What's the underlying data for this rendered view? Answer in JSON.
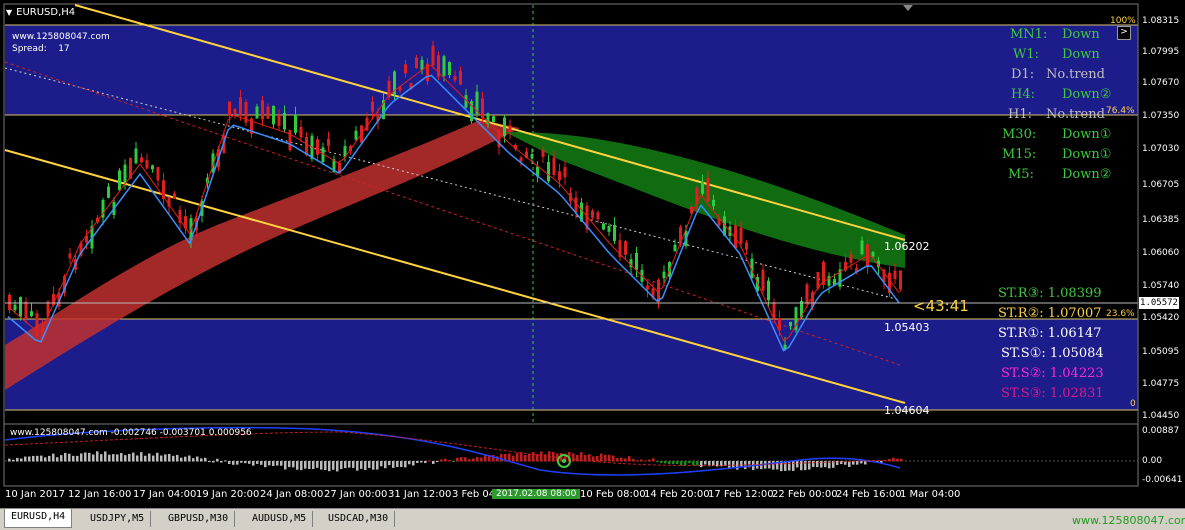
{
  "window": {
    "title": "EURUSD,H4"
  },
  "info": {
    "site": "www.125808047.com",
    "spread_label": "Spread:",
    "spread_value": "17"
  },
  "price_axis": [
    "1.08315",
    "1.07995",
    "1.07670",
    "1.07350",
    "1.07030",
    "1.06705",
    "1.06385",
    "1.06060",
    "1.05740",
    "1.05420",
    "1.05095",
    "1.04775",
    "1.04450"
  ],
  "date_axis": [
    "10 Jan 2017",
    "12 Jan 16:00",
    "17 Jan 04:00",
    "19 Jan 20:00",
    "24 Jan 08:00",
    "27 Jan 00:00",
    "31 Jan 12:00",
    "3 Feb 04:",
    "10 Feb 08:00",
    "14 Feb 20:00",
    "17 Feb 12:00",
    "22 Feb 00:00",
    "24 Feb 16:00",
    "1 Mar 04:00"
  ],
  "date_cursor": "2017.02.08 08:00",
  "fib_levels": [
    "100%",
    "76.4%",
    "23.6%",
    "0"
  ],
  "mtf_trend": [
    {
      "tf": "MN1:",
      "trend": "Down"
    },
    {
      "tf": "W1:",
      "trend": "Down"
    },
    {
      "tf": "D1:",
      "trend": "No.trend"
    },
    {
      "tf": "H4:",
      "trend": "Down②"
    },
    {
      "tf": "H1:",
      "trend": "No.trend"
    },
    {
      "tf": "M30:",
      "trend": "Down①"
    },
    {
      "tf": "M15:",
      "trend": "Down①"
    },
    {
      "tf": "M5:",
      "trend": "Down②"
    }
  ],
  "support_resistance": [
    {
      "label": "ST.R③: 1.08399",
      "color": "#3ec93e"
    },
    {
      "label": "ST.R②: 1.07007",
      "color": "#ffd23f"
    },
    {
      "label": "ST.R①: 1.06147",
      "color": "#ffffff"
    },
    {
      "label": "ST.S①: 1.05084",
      "color": "#ffffff"
    },
    {
      "label": "ST.S②: 1.04223",
      "color": "#ff2bd0"
    },
    {
      "label": "ST.S③: 1.02831",
      "color": "#d81b8a"
    }
  ],
  "price_labels": {
    "high": "1.06202",
    "mid": "1.05403",
    "low": "1.04604"
  },
  "current_price": "1.05572",
  "countdown": "<43:41",
  "expand_button": ">",
  "oscillator": {
    "label": "www.125808047.com -0.002746 -0.003701 0.000956",
    "ticks": [
      "0.00887",
      "0.00",
      "-0.00641"
    ]
  },
  "tabs": [
    "EURUSD,H4",
    "USDJPY,M5",
    "GBPUSD,M30",
    "AUDUSD,M5",
    "USDCAD,M30"
  ],
  "watermark": "www.125808047.com",
  "colors": {
    "zone_blue": "#1c1c8a",
    "trend_line": "#ffd23f",
    "bull": "#2ecc40",
    "bear": "#e02020",
    "ma_blue": "#3a8fff",
    "cloud_red": "#c0302f",
    "cloud_green": "#116b11"
  }
}
